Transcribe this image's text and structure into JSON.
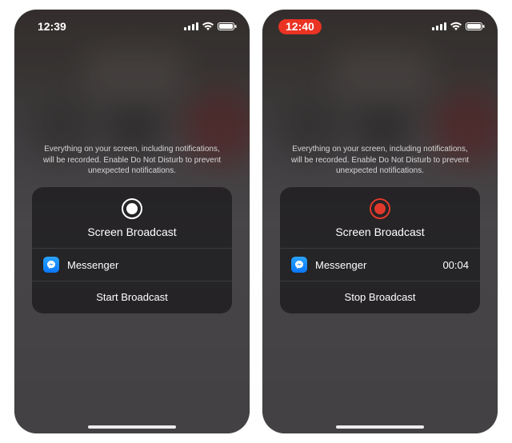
{
  "notice_text": "Everything on your screen, including notifications, will be recorded. Enable Do Not Disturb to prevent unexpected notifications.",
  "left": {
    "time": "12:39",
    "recording_pill": false,
    "card": {
      "title": "Screen Broadcast",
      "app_label": "Messenger",
      "timer": "",
      "action_label": "Start Broadcast",
      "icon_ring": "#ffffff",
      "icon_dot": "#ffffff"
    }
  },
  "right": {
    "time": "12:40",
    "recording_pill": true,
    "card": {
      "title": "Screen Broadcast",
      "app_label": "Messenger",
      "timer": "00:04",
      "action_label": "Stop Broadcast",
      "icon_ring": "#e0392b",
      "icon_dot": "#e0392b"
    }
  }
}
